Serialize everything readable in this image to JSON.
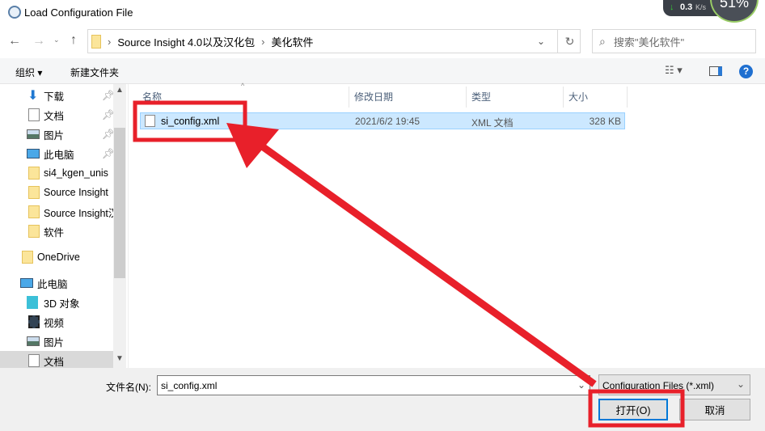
{
  "window": {
    "title": "Load Configuration File"
  },
  "widget": {
    "speed": "0.3",
    "unit": "K/s",
    "percent": "51%"
  },
  "address": {
    "path": [
      "Source Insight 4.0以及汉化包",
      "美化软件"
    ],
    "search_placeholder": "搜索\"美化软件\""
  },
  "toolbar": {
    "organize": "组织 ▾",
    "new_folder": "新建文件夹"
  },
  "sidebar": {
    "items": [
      {
        "label": "下载",
        "icon": "download-icon",
        "pinned": true
      },
      {
        "label": "文档",
        "icon": "document-icon",
        "pinned": true
      },
      {
        "label": "图片",
        "icon": "pictures-icon",
        "pinned": true
      },
      {
        "label": "此电脑",
        "icon": "computer-icon",
        "pinned": true
      },
      {
        "label": "si4_kgen_unis",
        "icon": "folder-icon"
      },
      {
        "label": "Source Insight",
        "icon": "folder-icon"
      },
      {
        "label": "Source Insight汉",
        "icon": "folder-icon"
      },
      {
        "label": "软件",
        "icon": "folder-icon"
      },
      {
        "label": "OneDrive",
        "icon": "folder-icon"
      },
      {
        "label": "此电脑",
        "icon": "computer-icon"
      },
      {
        "label": "3D 对象",
        "icon": "3d-objects-icon"
      },
      {
        "label": "视频",
        "icon": "video-icon"
      },
      {
        "label": "图片",
        "icon": "pictures-icon"
      },
      {
        "label": "文档",
        "icon": "document-icon",
        "selected": true
      }
    ]
  },
  "columns": [
    "名称",
    "修改日期",
    "类型",
    "大小"
  ],
  "files": [
    {
      "name": "si_config.xml",
      "date": "2021/6/2 19:45",
      "type": "XML 文档",
      "size": "328 KB"
    }
  ],
  "footer": {
    "filename_label": "文件名(N):",
    "filename_value": "si_config.xml",
    "filter": "Configuration Files (*.xml)",
    "open": "打开(O)",
    "cancel": "取消"
  },
  "annotation_color": "#e8202a"
}
